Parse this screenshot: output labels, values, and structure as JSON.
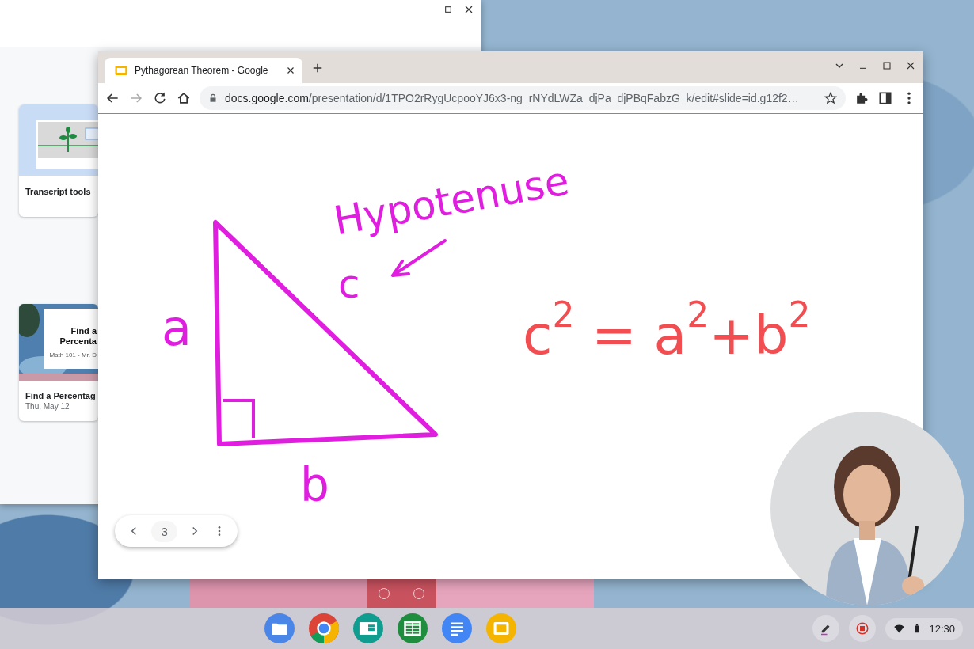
{
  "background_window": {
    "cards": [
      {
        "kind": "plant",
        "title": "Transcript tools"
      },
      {
        "kind": "slide",
        "title": "Find a Percentag",
        "date": "Thu, May 12",
        "thumbnail_title": "Find a Percenta",
        "thumbnail_subtitle": "Math 101 - Mr. D"
      }
    ]
  },
  "browser": {
    "tabs": [
      {
        "title": "Pythagorean Theorem - Google",
        "selected": true
      }
    ],
    "url": {
      "host": "docs.google.com",
      "path": "/presentation/d/1TPO2rRygUcpooYJ6x3-ng_rNYdLWZa_djPa_djPBqFabzG_k/edit#slide=id.g12f2…"
    },
    "slide": {
      "labels": [
        {
          "kind": "hypotenuse",
          "text": "Hypotenuse"
        },
        {
          "kind": "side-c",
          "text": "c"
        },
        {
          "kind": "side-a",
          "text": "a"
        },
        {
          "kind": "side-b",
          "text": "b"
        }
      ],
      "equation": "c$^{2}$ = a$^{2}$+b$^{2}$"
    },
    "slide_nav": {
      "page": "3"
    }
  },
  "taskbar": {
    "apps": [
      {
        "kind": "files"
      },
      {
        "kind": "chrome"
      },
      {
        "kind": "classroom"
      },
      {
        "kind": "sheets"
      },
      {
        "kind": "docs"
      },
      {
        "kind": "slides"
      }
    ],
    "time": "12:30"
  }
}
